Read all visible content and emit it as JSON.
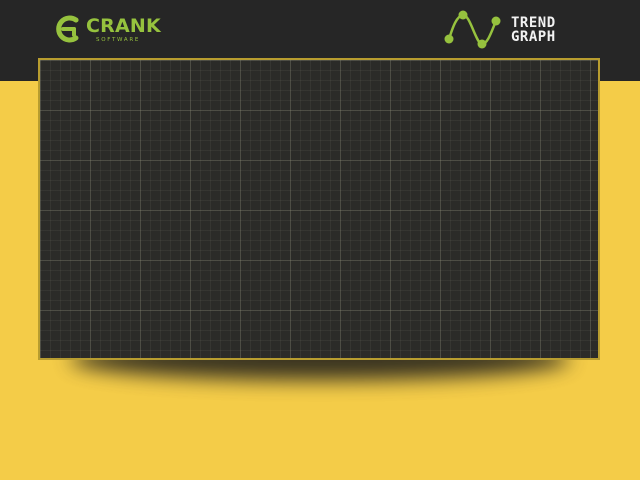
{
  "header": {
    "brand": {
      "name": "CRANK",
      "tagline": "SOFTWARE",
      "icon": "crank-logo-icon"
    },
    "app_logo": {
      "icon": "trend-wave-icon",
      "line1": "TREND",
      "line2": "GRAPH"
    }
  },
  "colors": {
    "background": "#f4cc48",
    "header_bar": "#262626",
    "brand_green": "#96c23e",
    "graph_background": "#2b2b28",
    "graph_border": "#b89d2f",
    "grid_line": "#5a5a50"
  },
  "graph": {
    "grid": true
  }
}
